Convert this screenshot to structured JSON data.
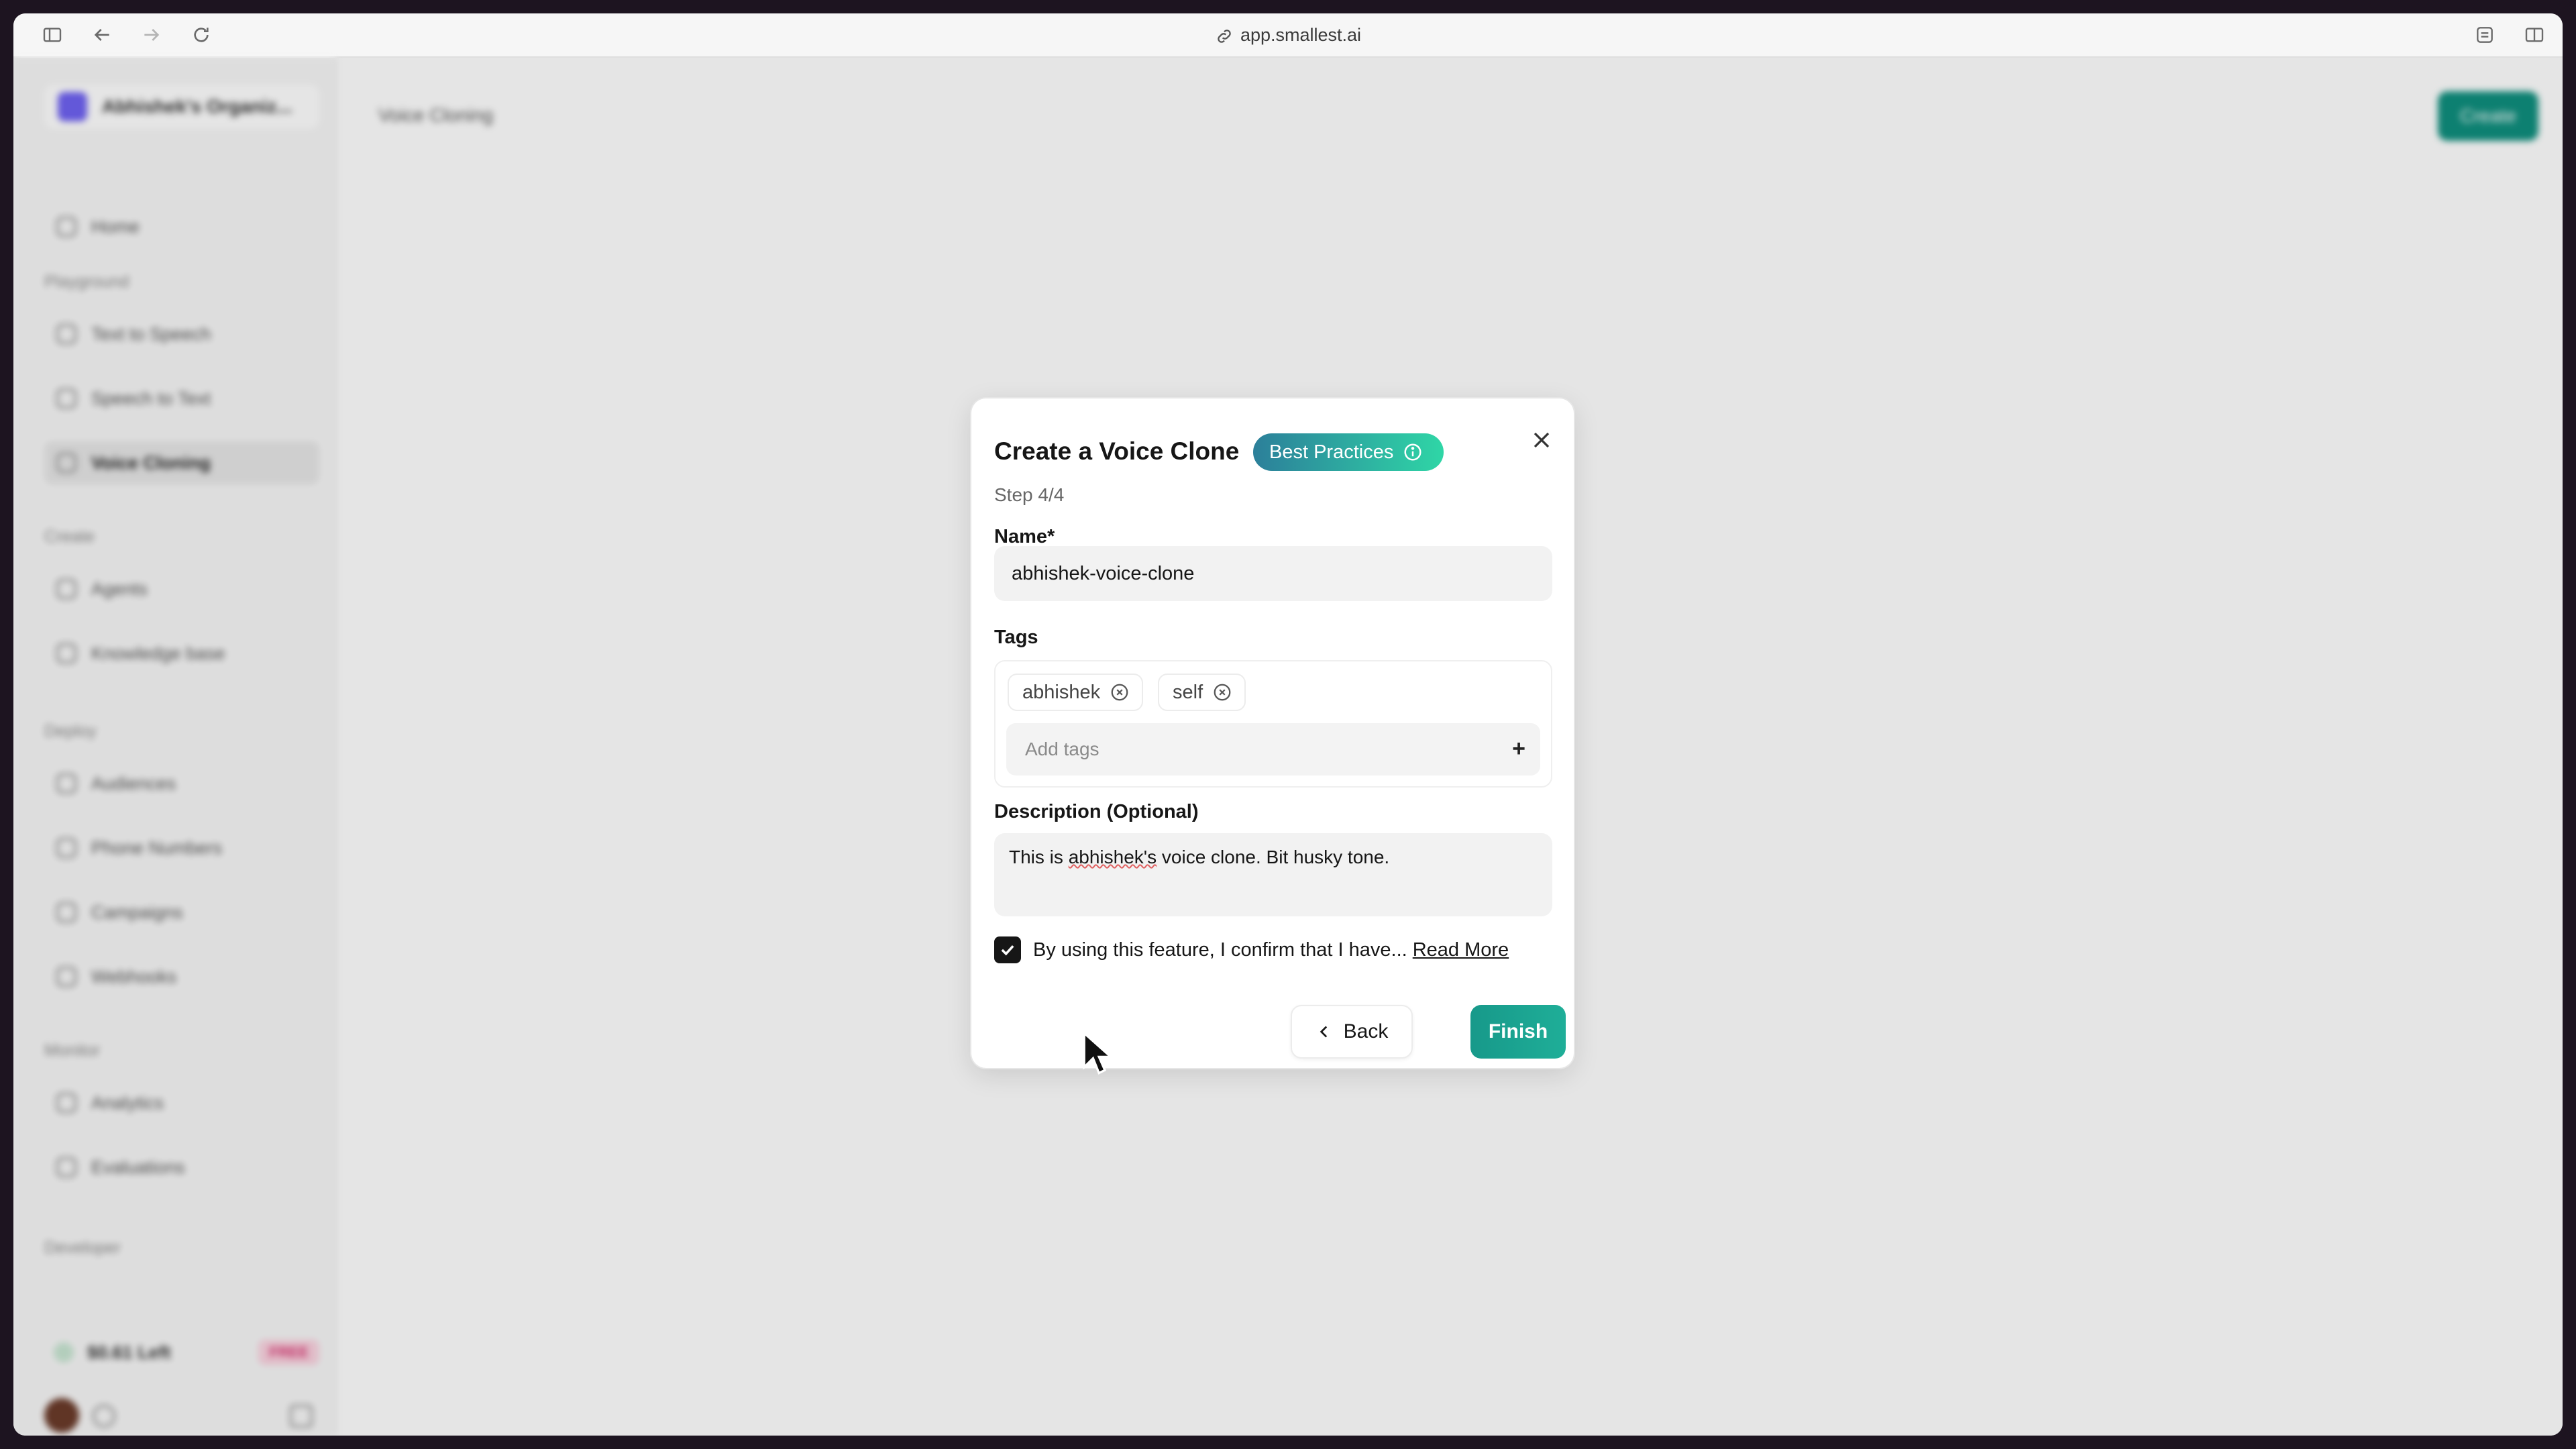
{
  "browser": {
    "url": "app.smallest.ai"
  },
  "sidebar": {
    "org_name": "Abhishek's Organiz...",
    "home": "Home",
    "sections": {
      "playground": "Playground",
      "create": "Create",
      "deploy": "Deploy",
      "monitor": "Monitor",
      "developer": "Developer"
    },
    "items": {
      "text_to_speech": "Text to Speech",
      "speech_to_text": "Speech to Text",
      "voice_cloning": "Voice Cloning",
      "agents": "Agents",
      "knowledge_base": "Knowledge base",
      "audiences": "Audiences",
      "phone_numbers": "Phone Numbers",
      "campaigns": "Campaigns",
      "webhooks": "Webhooks",
      "analytics": "Analytics",
      "evaluations": "Evaluations"
    },
    "plan": "$0.61 Left",
    "plan_badge": "FREE"
  },
  "main": {
    "breadcrumb": "Voice Cloning",
    "create_button": "Create"
  },
  "modal": {
    "title": "Create a Voice Clone",
    "badge": "Best Practices",
    "step": "Step 4/4",
    "name_label": "Name*",
    "name_value": "abhishek-voice-clone",
    "tags_label": "Tags",
    "tags": [
      "abhishek",
      "self"
    ],
    "tags_placeholder": "Add tags",
    "tags_add": "+",
    "description_label": "Description (Optional)",
    "description_pre": "This is ",
    "description_flagged": "abhishek's",
    "description_post": " voice clone. Bit husky tone.",
    "consent_text": "By using this feature, I confirm that I have...",
    "consent_checked": true,
    "read_more": "Read More",
    "back_button": "Back",
    "finish_button": "Finish"
  },
  "colors": {
    "accent": "#17998a",
    "badge_start": "#2c7f9a",
    "badge_end": "#2fd6a6"
  }
}
